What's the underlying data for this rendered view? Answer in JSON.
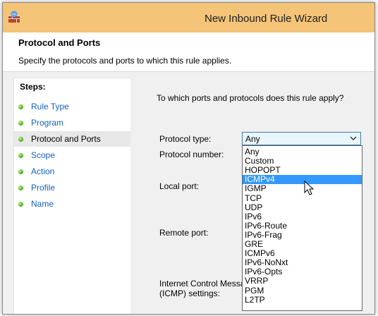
{
  "window": {
    "title": "New Inbound Rule Wizard"
  },
  "header": {
    "title": "Protocol and Ports",
    "subtitle": "Specify the protocols and ports to which this rule applies."
  },
  "steps": {
    "title": "Steps:",
    "items": [
      {
        "label": "Rule Type"
      },
      {
        "label": "Program"
      },
      {
        "label": "Protocol and Ports"
      },
      {
        "label": "Scope"
      },
      {
        "label": "Action"
      },
      {
        "label": "Profile"
      },
      {
        "label": "Name"
      }
    ],
    "active_index": 2
  },
  "main": {
    "question": "To which ports and protocols does this rule apply?",
    "protocol_type_label": "Protocol type:",
    "protocol_number_label": "Protocol number:",
    "local_port_label": "Local port:",
    "remote_port_label": "Remote port:",
    "icmp_label_line1": "Internet Control Message",
    "icmp_label_line2": "(ICMP) settings:"
  },
  "protocol_select": {
    "value": "Any",
    "options": [
      "Any",
      "Custom",
      "HOPOPT",
      "ICMPv4",
      "IGMP",
      "TCP",
      "UDP",
      "IPv6",
      "IPv6-Route",
      "IPv6-Frag",
      "GRE",
      "ICMPv6",
      "IPv6-NoNxt",
      "IPv6-Opts",
      "VRRP",
      "PGM",
      "L2TP"
    ],
    "highlighted": "ICMPv4"
  },
  "colors": {
    "titlebar": "#f4c478",
    "link": "#1560bd",
    "selection": "#3399ff",
    "step_dot": "#3aa510"
  },
  "icons": {
    "app": "firewall-icon",
    "step": "green-dot-icon",
    "chevron": "chevron-down-icon",
    "cursor": "mouse-pointer-icon"
  }
}
